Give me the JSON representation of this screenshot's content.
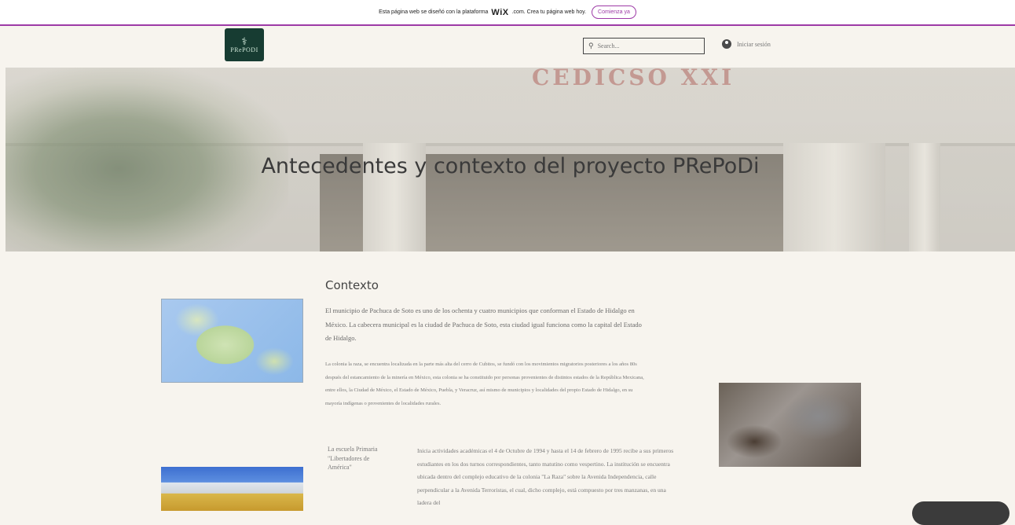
{
  "wix_banner": {
    "text_before": "Esta página web se diseñó con la plataforma",
    "brand": "WiX",
    "text_after": ".com. Crea tu página web hoy.",
    "cta": "Comienza ya"
  },
  "header": {
    "logo_text": "PRePODI",
    "search_placeholder": "Search...",
    "login_label": "Iniciar sesión"
  },
  "hero": {
    "sign_text": "CEDICSO XXI",
    "title": "Antecedentes y contexto del proyecto PRePoDi"
  },
  "content": {
    "section_title": "Contexto",
    "paragraph1": "El municipio de Pachuca de Soto es uno de los ochenta y cuatro municipios que conforman el Estado de Hidalgo en México. La cabecera municipal es la ciudad de Pachuca de Soto, esta ciudad igual funciona como la capital del Estado de Hidalgo.",
    "paragraph2": "La colonia la raza, se encuentra localizada en la parte más alta del cerro de Cubitos, se fundó con los movimientos migratorios posteriores a los años 80s después del estancamiento de la minería en México, esta colonia se ha constituido por personas provenientes de distintos estados de la República Mexicana, entre ellos, la Ciudad de México, el Estado de México, Puebla, y Veracruz, así mismo de municipios y localidades del propio Estado de Hidalgo, en su mayoría indígenas o provenientes de localidades rurales.",
    "school_caption": "La escuela Primaria \"Libertadores de América\"",
    "paragraph3": "Inicia actividades académicas el 4 de Octubre de 1994 y hasta el 14 de febrero de 1995 recibe a sus primeros estudiantes en los dos turnos correspondientes, tanto matutino como vespertino. La institución se encuentra ubicada dentro del complejo educativo de la colonia \"La Raza\" sobre la Avenida Independencia, calle perpendicular a la Avenida Terroristas, el cual, dicho complejo, está compuesto por tres manzanas, en una ladera del"
  }
}
